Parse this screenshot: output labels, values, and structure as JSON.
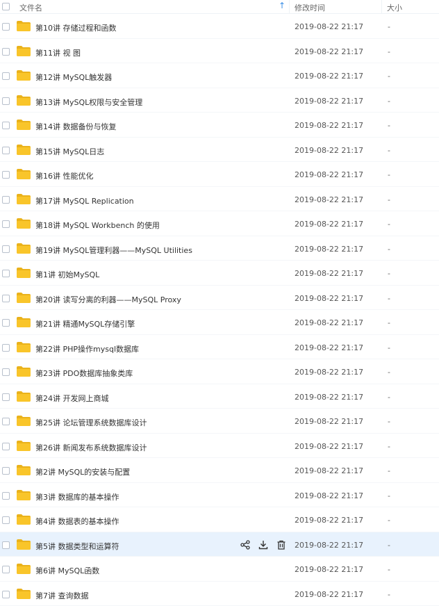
{
  "header": {
    "name_label": "文件名",
    "sort_icon": "arrow-up-icon",
    "time_label": "修改时间",
    "size_label": "大小"
  },
  "colors": {
    "folder": "#f9c52a",
    "folder_dark": "#eab21b",
    "accent": "#3a8ee6",
    "hover_row": "#e8f2fd"
  },
  "rows": [
    {
      "name": "第10讲 存储过程和函数",
      "time": "2019-08-22 21:17",
      "size": "-"
    },
    {
      "name": "第11讲  视  图",
      "time": "2019-08-22 21:17",
      "size": "-"
    },
    {
      "name": "第12讲  MySQL触发器",
      "time": "2019-08-22 21:17",
      "size": "-"
    },
    {
      "name": "第13讲  MySQL权限与安全管理",
      "time": "2019-08-22 21:17",
      "size": "-"
    },
    {
      "name": "第14讲  数据备份与恢复",
      "time": "2019-08-22 21:17",
      "size": "-"
    },
    {
      "name": "第15讲  MySQL日志",
      "time": "2019-08-22 21:17",
      "size": "-"
    },
    {
      "name": "第16讲  性能优化",
      "time": "2019-08-22 21:17",
      "size": "-"
    },
    {
      "name": "第17讲  MySQL Replication",
      "time": "2019-08-22 21:17",
      "size": "-"
    },
    {
      "name": "第18讲  MySQL Workbench 的使用",
      "time": "2019-08-22 21:17",
      "size": "-"
    },
    {
      "name": "第19讲   MySQL管理利器——MySQL Utilities",
      "time": "2019-08-22 21:17",
      "size": "-"
    },
    {
      "name": "第1讲 初始MySQL",
      "time": "2019-08-22 21:17",
      "size": "-"
    },
    {
      "name": "第20讲  读写分离的利器——MySQL Proxy",
      "time": "2019-08-22 21:17",
      "size": "-"
    },
    {
      "name": "第21讲  精通MySQL存储引擎",
      "time": "2019-08-22 21:17",
      "size": "-"
    },
    {
      "name": "第22讲  PHP操作mysql数据库",
      "time": "2019-08-22 21:17",
      "size": "-"
    },
    {
      "name": "第23讲  PDO数据库抽象类库",
      "time": "2019-08-22 21:17",
      "size": "-"
    },
    {
      "name": "第24讲  开发网上商城",
      "time": "2019-08-22 21:17",
      "size": "-"
    },
    {
      "name": "第25讲   论坛管理系统数据库设计",
      "time": "2019-08-22 21:17",
      "size": "-"
    },
    {
      "name": "第26讲  新闻发布系统数据库设计",
      "time": "2019-08-22 21:17",
      "size": "-"
    },
    {
      "name": "第2讲 MySQL的安装与配置",
      "time": "2019-08-22 21:17",
      "size": "-"
    },
    {
      "name": "第3讲  数据库的基本操作",
      "time": "2019-08-22 21:17",
      "size": "-"
    },
    {
      "name": "第4讲  数据表的基本操作",
      "time": "2019-08-22 21:17",
      "size": "-"
    },
    {
      "name": "第5讲  数据类型和运算符",
      "time": "2019-08-22 21:17",
      "size": "-",
      "hover": true,
      "actions": [
        "share-icon",
        "download-icon",
        "delete-icon"
      ]
    },
    {
      "name": "第6讲  MySQL函数",
      "time": "2019-08-22 21:17",
      "size": "-"
    },
    {
      "name": "第7讲  查询数据",
      "time": "2019-08-22 21:17",
      "size": "-"
    }
  ]
}
